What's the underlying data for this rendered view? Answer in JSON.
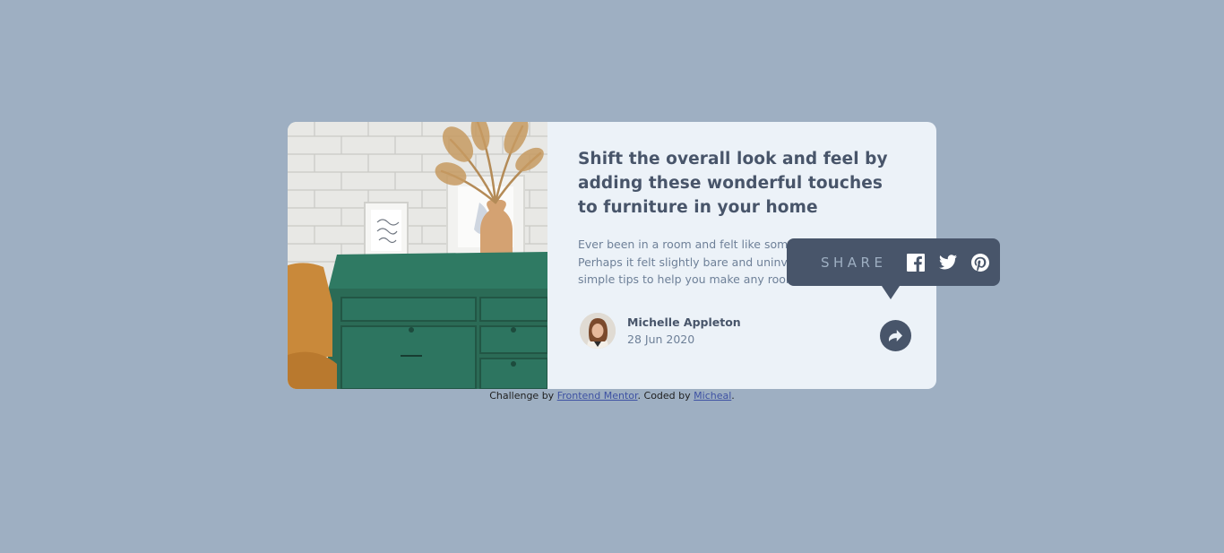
{
  "article": {
    "title": "Shift the overall look and feel by adding these wonderful touches to furniture in your home",
    "excerpt": "Ever been in a room and felt like something was missing? Perhaps it felt slightly bare and uninviting. I’ve got some simple tips to help you make any room feel complete.",
    "image_icon": "drawers-photo"
  },
  "author": {
    "name": "Michelle Appleton",
    "date": "28 Jun 2020",
    "avatar_icon": "avatar-photo"
  },
  "share": {
    "label": "SHARE",
    "button_icon": "share-icon",
    "socials": [
      {
        "name": "facebook-icon"
      },
      {
        "name": "twitter-icon"
      },
      {
        "name": "pinterest-icon"
      }
    ]
  },
  "attribution": {
    "prefix": "Challenge by ",
    "link1": "Frontend Mentor",
    "middle": ". Coded by ",
    "link2": "Micheal",
    "suffix": "."
  },
  "colors": {
    "background": "#9eafc2",
    "card": "#ecf2f8",
    "dark": "#48556a",
    "muted": "#6e8098",
    "light": "#9eafc2"
  }
}
